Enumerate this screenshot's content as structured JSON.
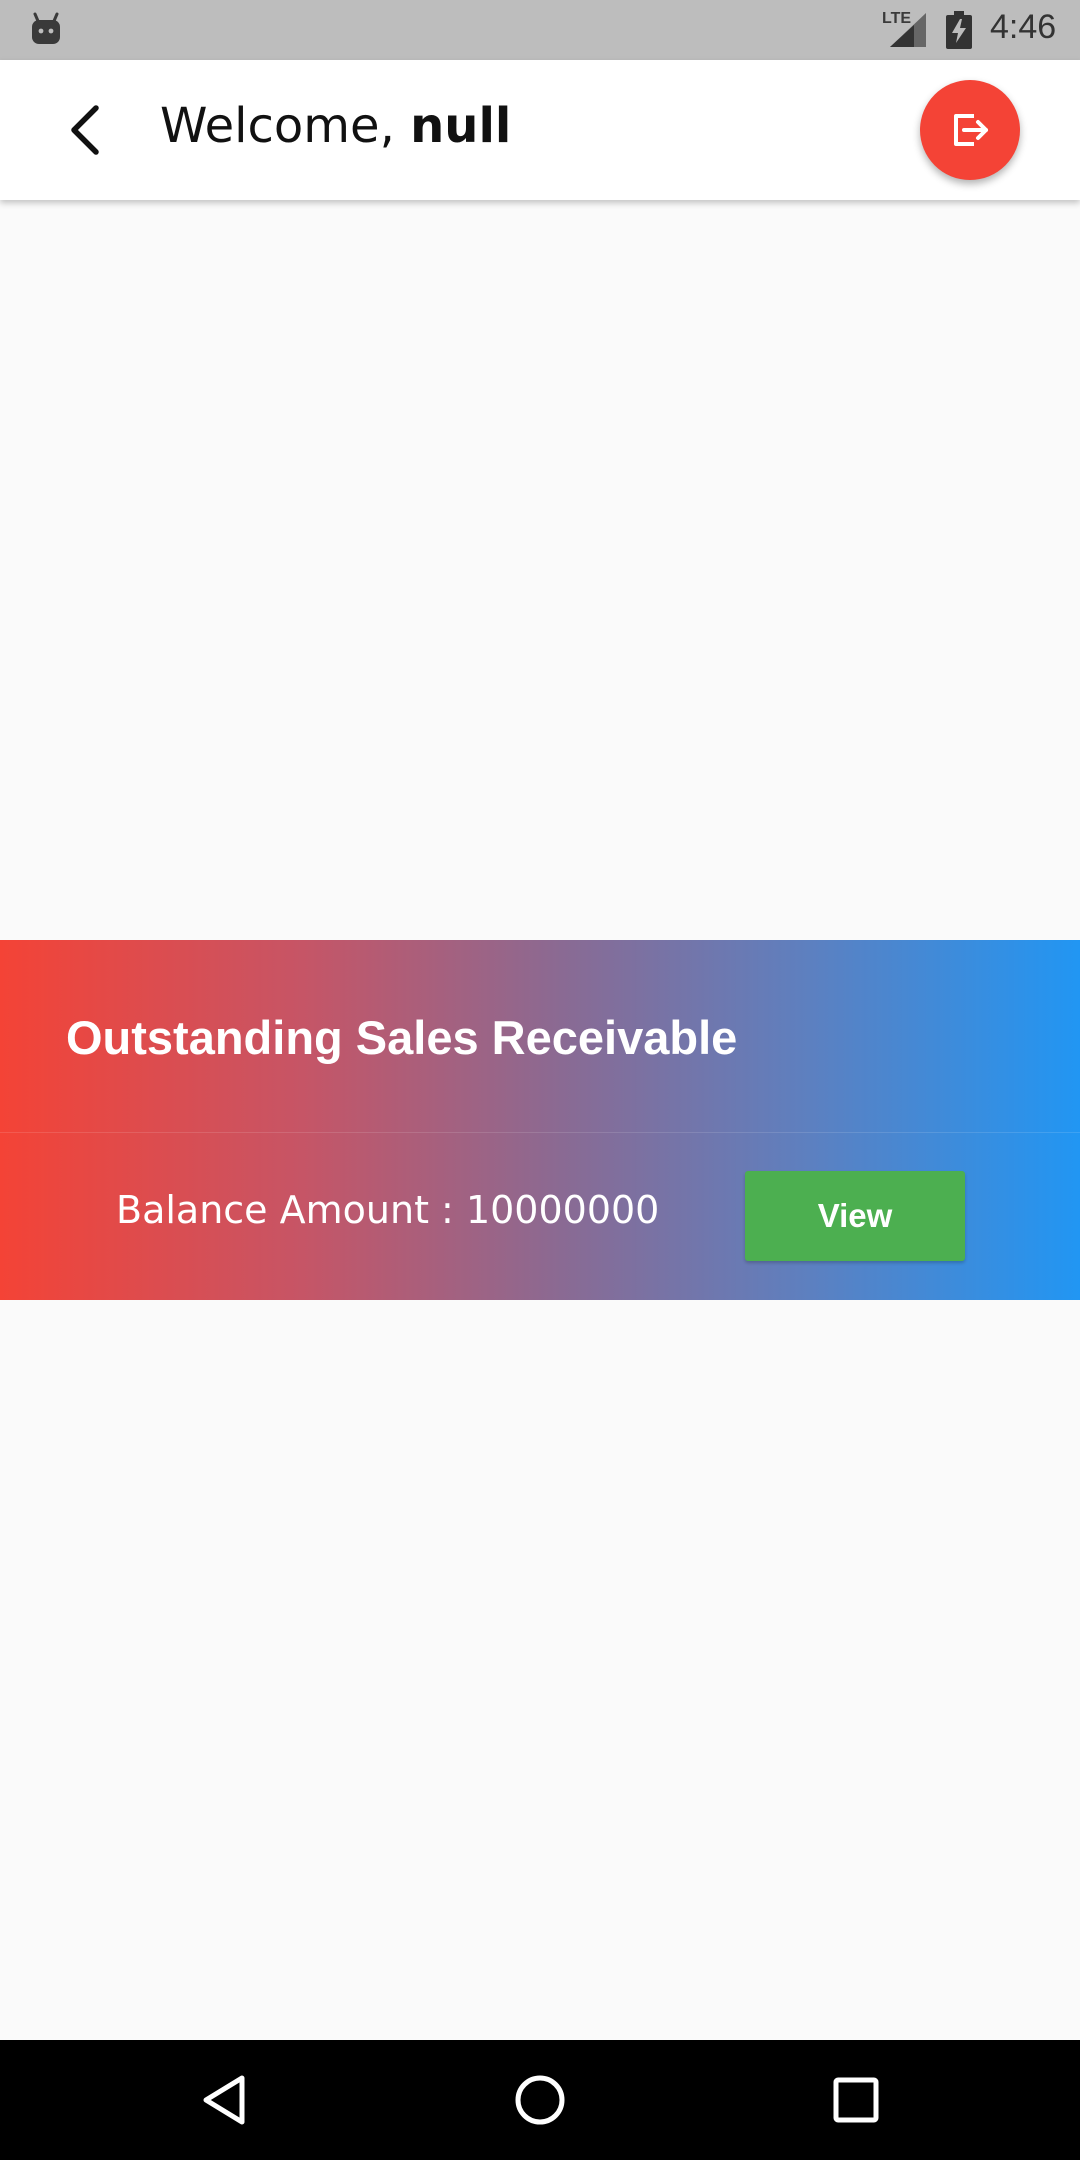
{
  "status_bar": {
    "network_label": "LTE",
    "time": "4:46",
    "icons": [
      "android-notification-icon",
      "signal-icon",
      "battery-charging-icon"
    ]
  },
  "app_bar": {
    "greeting": "Welcome,",
    "user_name": "null",
    "back_icon": "arrow-back-icon",
    "logout_icon": "logout-icon",
    "logout_color": "#f44336"
  },
  "receivable_card": {
    "title": "Outstanding Sales Receivable",
    "balance_label": "Balance Amount :",
    "balance_value": "10000000",
    "view_label": "View",
    "gradient_start": "#f44336",
    "gradient_end": "#2196f3",
    "view_color": "#4caf50"
  },
  "nav_bar": {
    "icons": [
      "nav-back-icon",
      "nav-home-icon",
      "nav-recents-icon"
    ]
  }
}
